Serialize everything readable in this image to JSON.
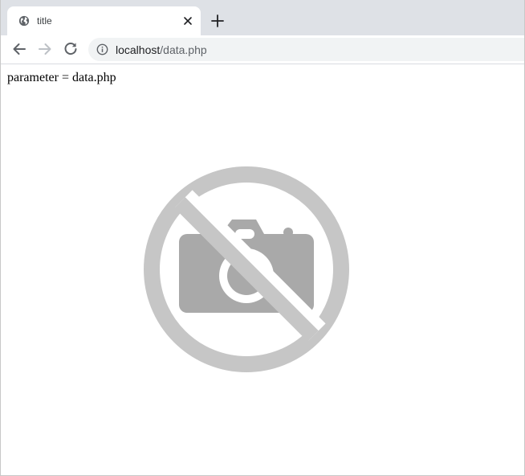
{
  "browser": {
    "tab": {
      "title": "title",
      "favicon": "globe-icon",
      "close": "close-icon"
    },
    "new_tab": "plus-icon",
    "toolbar": {
      "back": "arrow-left-icon",
      "forward": "arrow-right-icon",
      "reload": "reload-icon",
      "site_info": "info-icon"
    },
    "address": {
      "host": "localhost",
      "path": "/data.php"
    }
  },
  "page": {
    "text": "parameter = data.php",
    "image": "no-photo-icon"
  },
  "colors": {
    "tabstrip": "#dee1e6",
    "omnibox": "#f1f3f4",
    "icon": "#5f6368",
    "forward_disabled": "#bdc1c6",
    "no_photo_ring": "#c6c6c6",
    "no_photo_camera": "#a9a9a9"
  }
}
